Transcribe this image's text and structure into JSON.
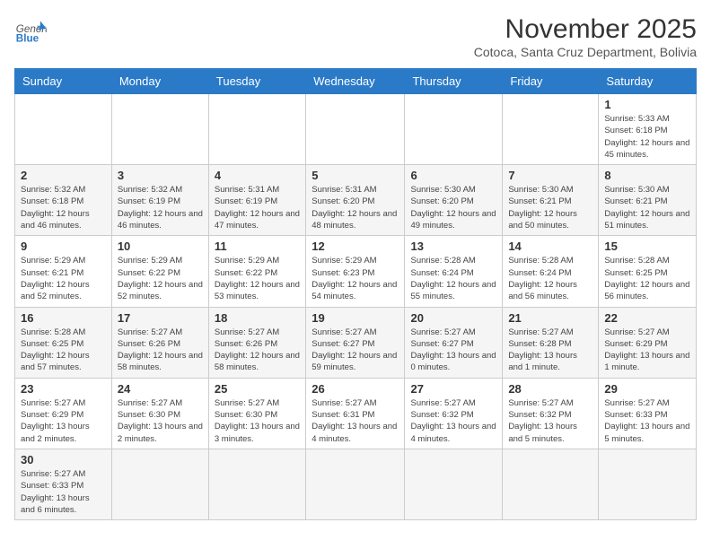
{
  "header": {
    "logo_general": "General",
    "logo_blue": "Blue",
    "month_year": "November 2025",
    "location": "Cotoca, Santa Cruz Department, Bolivia"
  },
  "days_of_week": [
    "Sunday",
    "Monday",
    "Tuesday",
    "Wednesday",
    "Thursday",
    "Friday",
    "Saturday"
  ],
  "weeks": [
    [
      {
        "day": "",
        "info": ""
      },
      {
        "day": "",
        "info": ""
      },
      {
        "day": "",
        "info": ""
      },
      {
        "day": "",
        "info": ""
      },
      {
        "day": "",
        "info": ""
      },
      {
        "day": "",
        "info": ""
      },
      {
        "day": "1",
        "info": "Sunrise: 5:33 AM\nSunset: 6:18 PM\nDaylight: 12 hours and 45 minutes."
      }
    ],
    [
      {
        "day": "2",
        "info": "Sunrise: 5:32 AM\nSunset: 6:18 PM\nDaylight: 12 hours and 46 minutes."
      },
      {
        "day": "3",
        "info": "Sunrise: 5:32 AM\nSunset: 6:19 PM\nDaylight: 12 hours and 46 minutes."
      },
      {
        "day": "4",
        "info": "Sunrise: 5:31 AM\nSunset: 6:19 PM\nDaylight: 12 hours and 47 minutes."
      },
      {
        "day": "5",
        "info": "Sunrise: 5:31 AM\nSunset: 6:20 PM\nDaylight: 12 hours and 48 minutes."
      },
      {
        "day": "6",
        "info": "Sunrise: 5:30 AM\nSunset: 6:20 PM\nDaylight: 12 hours and 49 minutes."
      },
      {
        "day": "7",
        "info": "Sunrise: 5:30 AM\nSunset: 6:21 PM\nDaylight: 12 hours and 50 minutes."
      },
      {
        "day": "8",
        "info": "Sunrise: 5:30 AM\nSunset: 6:21 PM\nDaylight: 12 hours and 51 minutes."
      }
    ],
    [
      {
        "day": "9",
        "info": "Sunrise: 5:29 AM\nSunset: 6:21 PM\nDaylight: 12 hours and 52 minutes."
      },
      {
        "day": "10",
        "info": "Sunrise: 5:29 AM\nSunset: 6:22 PM\nDaylight: 12 hours and 52 minutes."
      },
      {
        "day": "11",
        "info": "Sunrise: 5:29 AM\nSunset: 6:22 PM\nDaylight: 12 hours and 53 minutes."
      },
      {
        "day": "12",
        "info": "Sunrise: 5:29 AM\nSunset: 6:23 PM\nDaylight: 12 hours and 54 minutes."
      },
      {
        "day": "13",
        "info": "Sunrise: 5:28 AM\nSunset: 6:24 PM\nDaylight: 12 hours and 55 minutes."
      },
      {
        "day": "14",
        "info": "Sunrise: 5:28 AM\nSunset: 6:24 PM\nDaylight: 12 hours and 56 minutes."
      },
      {
        "day": "15",
        "info": "Sunrise: 5:28 AM\nSunset: 6:25 PM\nDaylight: 12 hours and 56 minutes."
      }
    ],
    [
      {
        "day": "16",
        "info": "Sunrise: 5:28 AM\nSunset: 6:25 PM\nDaylight: 12 hours and 57 minutes."
      },
      {
        "day": "17",
        "info": "Sunrise: 5:27 AM\nSunset: 6:26 PM\nDaylight: 12 hours and 58 minutes."
      },
      {
        "day": "18",
        "info": "Sunrise: 5:27 AM\nSunset: 6:26 PM\nDaylight: 12 hours and 58 minutes."
      },
      {
        "day": "19",
        "info": "Sunrise: 5:27 AM\nSunset: 6:27 PM\nDaylight: 12 hours and 59 minutes."
      },
      {
        "day": "20",
        "info": "Sunrise: 5:27 AM\nSunset: 6:27 PM\nDaylight: 13 hours and 0 minutes."
      },
      {
        "day": "21",
        "info": "Sunrise: 5:27 AM\nSunset: 6:28 PM\nDaylight: 13 hours and 1 minute."
      },
      {
        "day": "22",
        "info": "Sunrise: 5:27 AM\nSunset: 6:29 PM\nDaylight: 13 hours and 1 minute."
      }
    ],
    [
      {
        "day": "23",
        "info": "Sunrise: 5:27 AM\nSunset: 6:29 PM\nDaylight: 13 hours and 2 minutes."
      },
      {
        "day": "24",
        "info": "Sunrise: 5:27 AM\nSunset: 6:30 PM\nDaylight: 13 hours and 2 minutes."
      },
      {
        "day": "25",
        "info": "Sunrise: 5:27 AM\nSunset: 6:30 PM\nDaylight: 13 hours and 3 minutes."
      },
      {
        "day": "26",
        "info": "Sunrise: 5:27 AM\nSunset: 6:31 PM\nDaylight: 13 hours and 4 minutes."
      },
      {
        "day": "27",
        "info": "Sunrise: 5:27 AM\nSunset: 6:32 PM\nDaylight: 13 hours and 4 minutes."
      },
      {
        "day": "28",
        "info": "Sunrise: 5:27 AM\nSunset: 6:32 PM\nDaylight: 13 hours and 5 minutes."
      },
      {
        "day": "29",
        "info": "Sunrise: 5:27 AM\nSunset: 6:33 PM\nDaylight: 13 hours and 5 minutes."
      }
    ],
    [
      {
        "day": "30",
        "info": "Sunrise: 5:27 AM\nSunset: 6:33 PM\nDaylight: 13 hours and 6 minutes."
      },
      {
        "day": "",
        "info": ""
      },
      {
        "day": "",
        "info": ""
      },
      {
        "day": "",
        "info": ""
      },
      {
        "day": "",
        "info": ""
      },
      {
        "day": "",
        "info": ""
      },
      {
        "day": "",
        "info": ""
      }
    ]
  ]
}
